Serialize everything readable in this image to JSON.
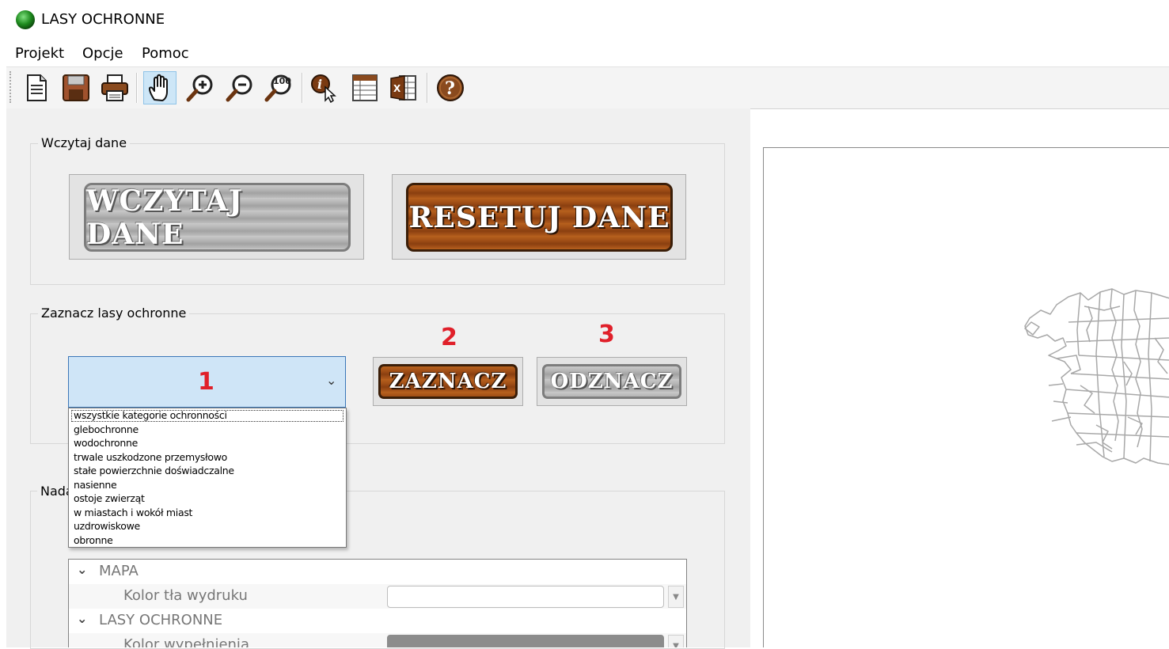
{
  "window": {
    "title": "LASY OCHRONNE"
  },
  "menu": {
    "items": [
      "Projekt",
      "Opcje",
      "Pomoc"
    ]
  },
  "toolbar": {
    "tools": [
      "new-document-icon",
      "save-icon",
      "print-icon",
      "pan-hand-icon",
      "zoom-in-icon",
      "zoom-out-icon",
      "zoom-100-icon",
      "identify-icon",
      "attribute-table-icon",
      "export-excel-icon",
      "help-icon"
    ],
    "active_tool": "pan-hand-icon",
    "zoom_100_label": "100"
  },
  "load_group": {
    "title": "Wczytaj dane",
    "load_button": "WCZYTAJ DANE",
    "reset_button": "RESETUJ DANE"
  },
  "select_group": {
    "title": "Zaznacz lasy ochronne",
    "step1": "1",
    "step2": "2",
    "step3": "3",
    "mark_button": "ZAZNACZ",
    "unmark_button": "ODZNACZ",
    "combo_options": [
      "wszystkie kategorie ochronności",
      "glebochronne",
      "wodochronne",
      "trwale uszkodzone przemysłowo",
      "stałe powierzchnie doświadczalne",
      "nasienne",
      "ostoje zwierząt",
      "w miastach i wokół miast",
      "uzdrowiskowe",
      "obronne"
    ]
  },
  "style_group": {
    "title_visible": "Nada",
    "sections": [
      {
        "name": "MAPA",
        "props": [
          {
            "label": "Kolor tła wydruku",
            "color": "#ffffff"
          }
        ]
      },
      {
        "name": "LASY OCHRONNE",
        "props": [
          {
            "label": "Kolor wypełnienia",
            "color": "#8c8c8c"
          }
        ]
      }
    ]
  },
  "map": {
    "stroke_color": "#a8a8a8",
    "background": "#ffffff"
  }
}
